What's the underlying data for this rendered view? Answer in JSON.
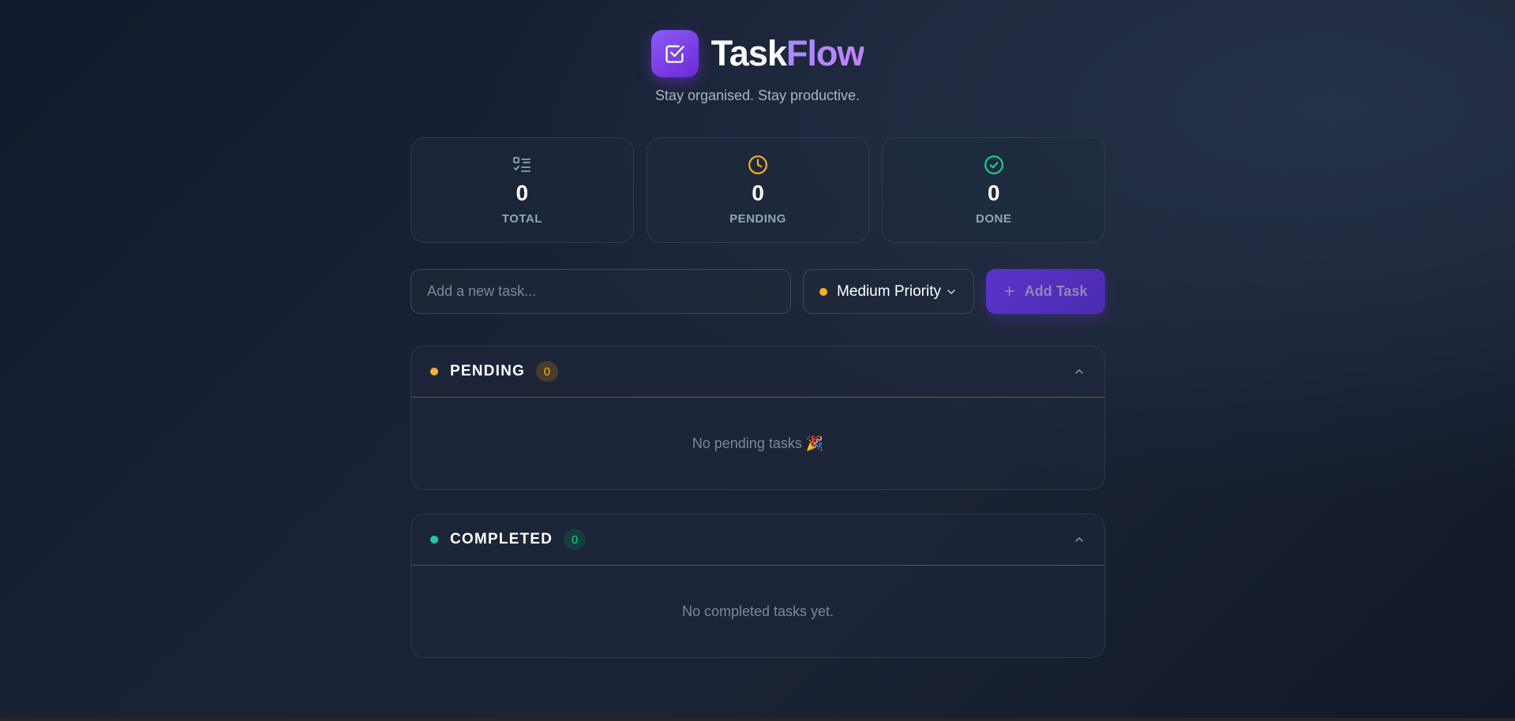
{
  "app": {
    "title_part1": "Task",
    "title_part2": "Flow",
    "subtitle": "Stay organised. Stay productive."
  },
  "stats": [
    {
      "icon": "checklist-icon",
      "value": "0",
      "label": "TOTAL",
      "color": "#94a3b8"
    },
    {
      "icon": "clock-icon",
      "value": "0",
      "label": "PENDING",
      "color": "#f5b517"
    },
    {
      "icon": "check-circle-icon",
      "value": "0",
      "label": "DONE",
      "color": "#10d39a"
    }
  ],
  "input": {
    "placeholder": "Add a new task...",
    "value": ""
  },
  "priority": {
    "selected": "Medium Priority",
    "color": "#f5b517"
  },
  "add_button": {
    "label": "Add Task"
  },
  "sections": {
    "pending": {
      "title": "PENDING",
      "count": "0",
      "empty_text": "No pending tasks 🎉",
      "color": "#f5b517"
    },
    "completed": {
      "title": "COMPLETED",
      "count": "0",
      "empty_text": "No completed tasks yet.",
      "color": "#10d39a"
    }
  },
  "colors": {
    "accent": "#7c3aed",
    "background": "#151d30"
  }
}
